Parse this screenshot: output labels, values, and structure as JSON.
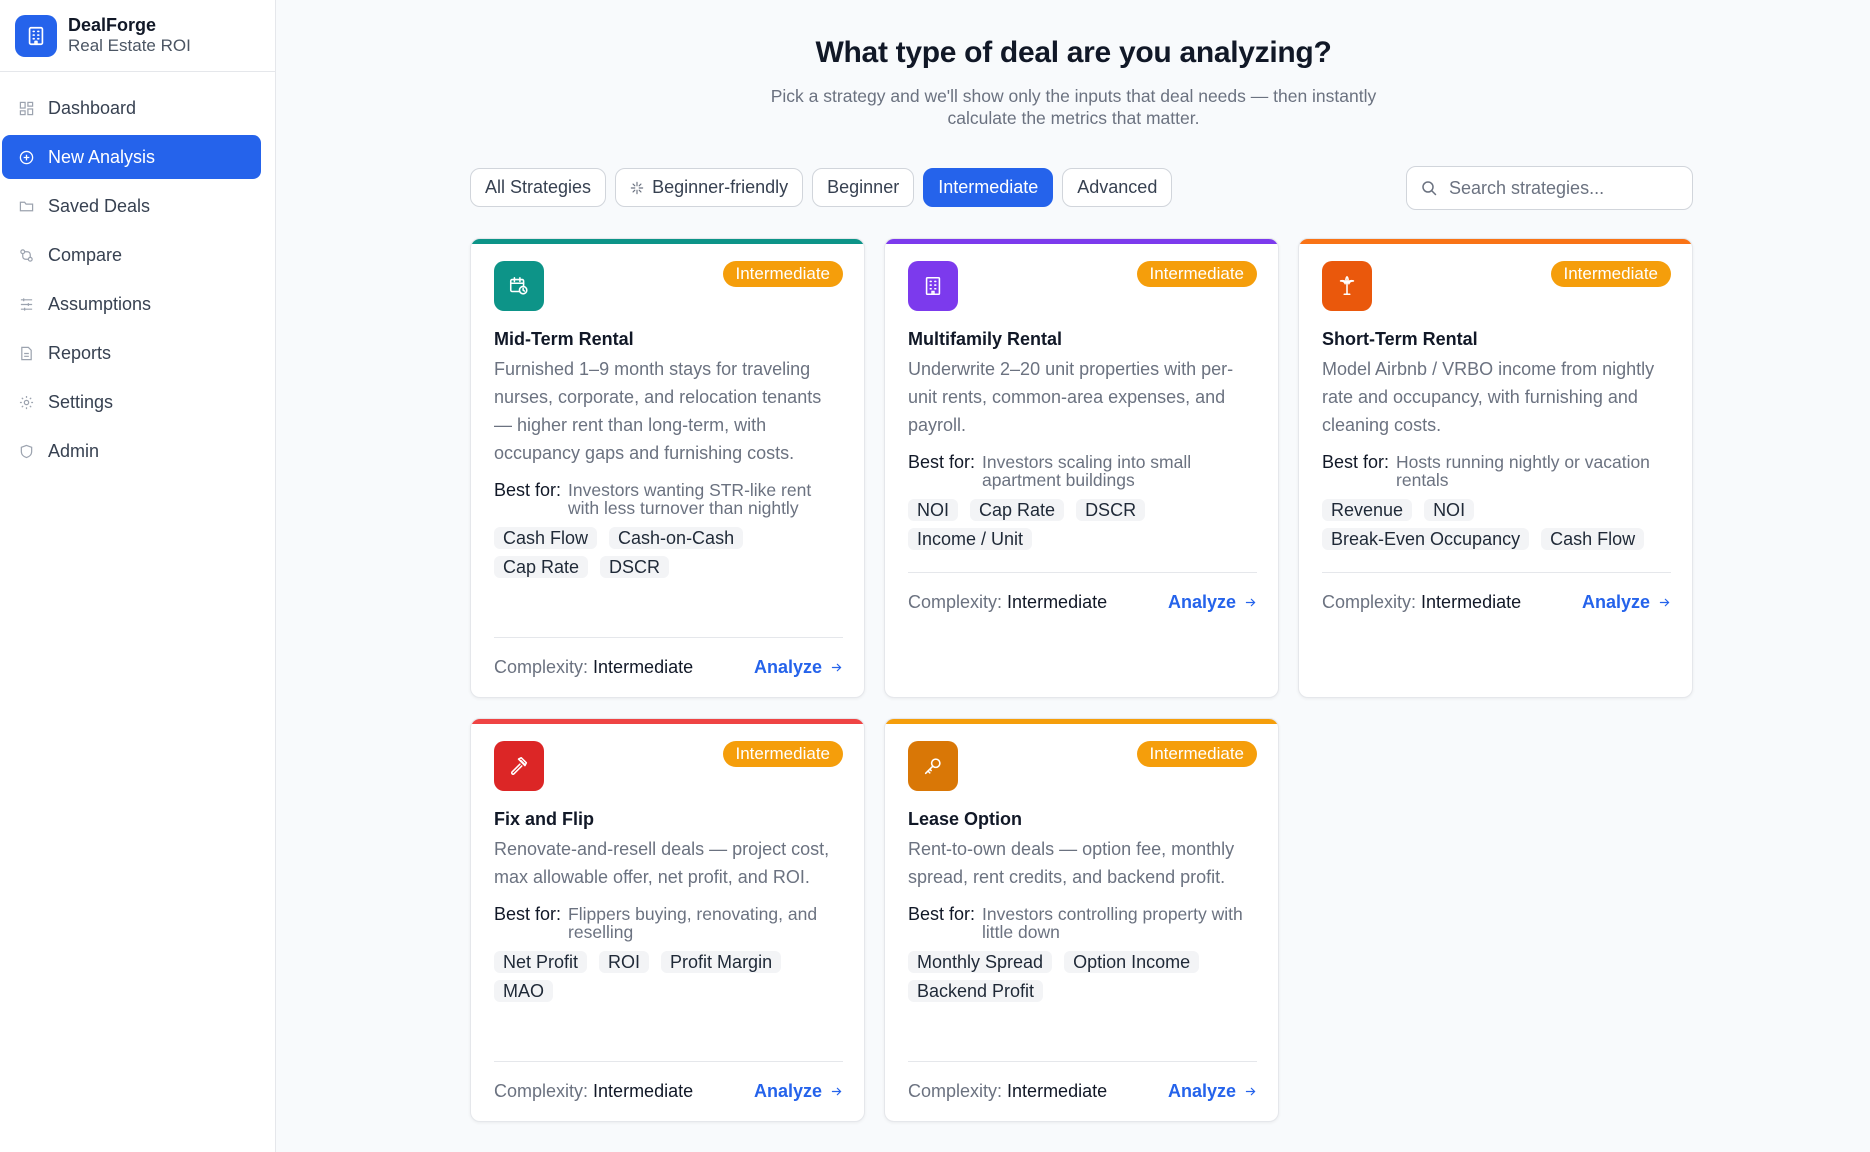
{
  "app": {
    "name": "DealForge",
    "subtitle": "Real Estate ROI"
  },
  "sidebar": {
    "items": [
      {
        "label": "Dashboard",
        "icon": "grid-icon",
        "active": false
      },
      {
        "label": "New Analysis",
        "icon": "plus-circle-icon",
        "active": true
      },
      {
        "label": "Saved Deals",
        "icon": "folder-icon",
        "active": false
      },
      {
        "label": "Compare",
        "icon": "compare-icon",
        "active": false
      },
      {
        "label": "Assumptions",
        "icon": "sliders-icon",
        "active": false
      },
      {
        "label": "Reports",
        "icon": "file-icon",
        "active": false
      },
      {
        "label": "Settings",
        "icon": "gear-icon",
        "active": false
      },
      {
        "label": "Admin",
        "icon": "shield-icon",
        "active": false
      }
    ]
  },
  "header": {
    "title": "What type of deal are you analyzing?",
    "subtitle": "Pick a strategy and we'll show only the inputs that deal needs — then instantly calculate the metrics that matter."
  },
  "filters": [
    {
      "label": "All Strategies",
      "active": false
    },
    {
      "label": "Beginner-friendly",
      "active": false,
      "icon": "sparkle-icon"
    },
    {
      "label": "Beginner",
      "active": false
    },
    {
      "label": "Intermediate",
      "active": true
    },
    {
      "label": "Advanced",
      "active": false
    }
  ],
  "search": {
    "placeholder": "Search strategies...",
    "value": ""
  },
  "labels": {
    "best_for": "Best for:",
    "complexity": "Complexity:",
    "analyze": "Analyze"
  },
  "colors": {
    "accent": "#2563eb",
    "badge": "#f59e0b",
    "teal": "#0d9488",
    "purple": "#7c3aed",
    "orange": "#ea580c",
    "red": "#dc2626",
    "amber": "#d97706"
  },
  "cards": [
    {
      "title": "Mid-Term Rental",
      "badge": "Intermediate",
      "icon": "calendar-clock-icon",
      "color": "#0d9488",
      "bar": "#0d9488",
      "description": "Furnished 1–9 month stays for traveling nurses, corporate, and relocation tenants — higher rent than long-term, with occupancy gaps and furnishing costs.",
      "best_for": "Investors wanting STR-like rent with less turnover than nightly",
      "tags": [
        "Cash Flow",
        "Cash-on-Cash",
        "Cap Rate",
        "DSCR"
      ],
      "complexity": "Intermediate"
    },
    {
      "title": "Multifamily Rental",
      "badge": "Intermediate",
      "icon": "building-icon",
      "color": "#7c3aed",
      "bar": "#7c3aed",
      "description": "Underwrite 2–20 unit properties with per-unit rents, common-area expenses, and payroll.",
      "best_for": "Investors scaling into small apartment buildings",
      "tags": [
        "NOI",
        "Cap Rate",
        "DSCR",
        "Income / Unit"
      ],
      "complexity": "Intermediate"
    },
    {
      "title": "Short-Term Rental",
      "badge": "Intermediate",
      "icon": "palm-tree-icon",
      "color": "#ea580c",
      "bar": "#f97316",
      "description": "Model Airbnb / VRBO income from nightly rate and occupancy, with furnishing and cleaning costs.",
      "best_for": "Hosts running nightly or vacation rentals",
      "tags": [
        "Revenue",
        "NOI",
        "Break-Even Occupancy",
        "Cash Flow"
      ],
      "complexity": "Intermediate"
    },
    {
      "title": "Fix and Flip",
      "badge": "Intermediate",
      "icon": "hammer-icon",
      "color": "#dc2626",
      "bar": "#ef4444",
      "description": "Renovate-and-resell deals — project cost, max allowable offer, net profit, and ROI.",
      "best_for": "Flippers buying, renovating, and reselling",
      "tags": [
        "Net Profit",
        "ROI",
        "Profit Margin",
        "MAO"
      ],
      "complexity": "Intermediate"
    },
    {
      "title": "Lease Option",
      "badge": "Intermediate",
      "icon": "key-icon",
      "color": "#d97706",
      "bar": "#f59e0b",
      "description": "Rent-to-own deals — option fee, monthly spread, rent credits, and backend profit.",
      "best_for": "Investors controlling property with little down",
      "tags": [
        "Monthly Spread",
        "Option Income",
        "Backend Profit"
      ],
      "complexity": "Intermediate"
    }
  ]
}
